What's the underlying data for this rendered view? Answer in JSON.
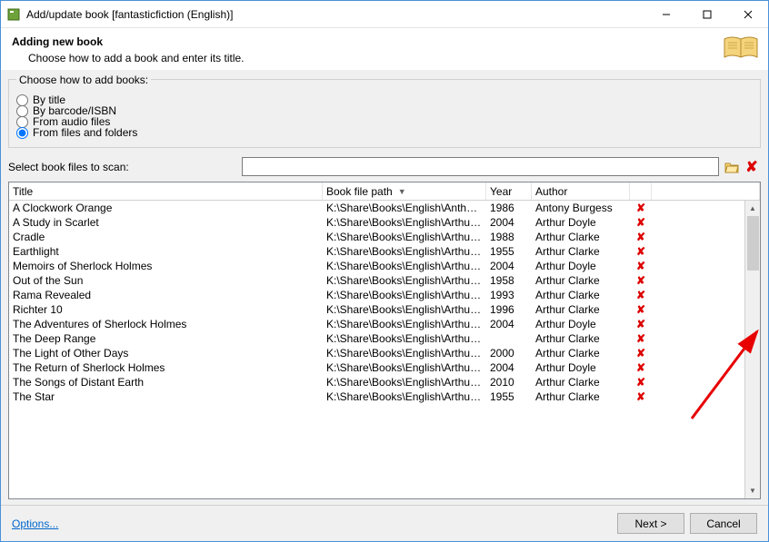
{
  "window_title": "Add/update book [fantasticfiction (English)]",
  "header": {
    "title": "Adding new book",
    "subtitle": "Choose how to add a book and enter its title."
  },
  "radio_group": {
    "legend": "Choose how to add books:",
    "options": [
      {
        "label": "By title",
        "checked": false
      },
      {
        "label": "By barcode/ISBN",
        "checked": false
      },
      {
        "label": "From audio files",
        "checked": false
      },
      {
        "label": "From files and folders",
        "checked": true
      }
    ]
  },
  "scan": {
    "label": "Select book files to scan:",
    "value": ""
  },
  "grid": {
    "columns": {
      "title": "Title",
      "path": "Book file path",
      "year": "Year",
      "author": "Author"
    },
    "rows": [
      {
        "title": "A Clockwork Orange",
        "path": "K:\\Share\\Books\\English\\Anthony ...",
        "year": "1986",
        "author": "Antony Burgess"
      },
      {
        "title": "A Study in Scarlet",
        "path": "K:\\Share\\Books\\English\\Arthur Co...",
        "year": "2004",
        "author": "Arthur Doyle"
      },
      {
        "title": "Cradle",
        "path": "K:\\Share\\Books\\English\\Arthur Cla...",
        "year": "1988",
        "author": "Arthur Clarke"
      },
      {
        "title": "Earthlight",
        "path": "K:\\Share\\Books\\English\\Arthur Cla...",
        "year": "1955",
        "author": "Arthur Clarke"
      },
      {
        "title": "Memoirs of Sherlock Holmes",
        "path": "K:\\Share\\Books\\English\\Arthur Co...",
        "year": "2004",
        "author": "Arthur Doyle"
      },
      {
        "title": "Out of the Sun",
        "path": "K:\\Share\\Books\\English\\Arthur Cla...",
        "year": "1958",
        "author": "Arthur Clarke"
      },
      {
        "title": "Rama Revealed",
        "path": "K:\\Share\\Books\\English\\Arthur Cla...",
        "year": "1993",
        "author": "Arthur Clarke"
      },
      {
        "title": "Richter 10",
        "path": "K:\\Share\\Books\\English\\Arthur Cla...",
        "year": "1996",
        "author": "Arthur Clarke"
      },
      {
        "title": "The Adventures of Sherlock Holmes",
        "path": "K:\\Share\\Books\\English\\Arthur Co...",
        "year": "2004",
        "author": "Arthur Doyle"
      },
      {
        "title": "The Deep Range",
        "path": "K:\\Share\\Books\\English\\Arthur Cla...",
        "year": "",
        "author": "Arthur Clarke"
      },
      {
        "title": "The Light of Other Days",
        "path": "K:\\Share\\Books\\English\\Arthur Cla...",
        "year": "2000",
        "author": "Arthur Clarke"
      },
      {
        "title": "The Return of Sherlock Holmes",
        "path": "K:\\Share\\Books\\English\\Arthur Co...",
        "year": "2004",
        "author": "Arthur Doyle"
      },
      {
        "title": "The Songs of Distant Earth",
        "path": "K:\\Share\\Books\\English\\Arthur Cla...",
        "year": "2010",
        "author": "Arthur Clarke"
      },
      {
        "title": "The Star",
        "path": "K:\\Share\\Books\\English\\Arthur Cla...",
        "year": "1955",
        "author": "Arthur Clarke"
      }
    ]
  },
  "footer": {
    "options": "Options...",
    "next": "Next >",
    "cancel": "Cancel"
  }
}
